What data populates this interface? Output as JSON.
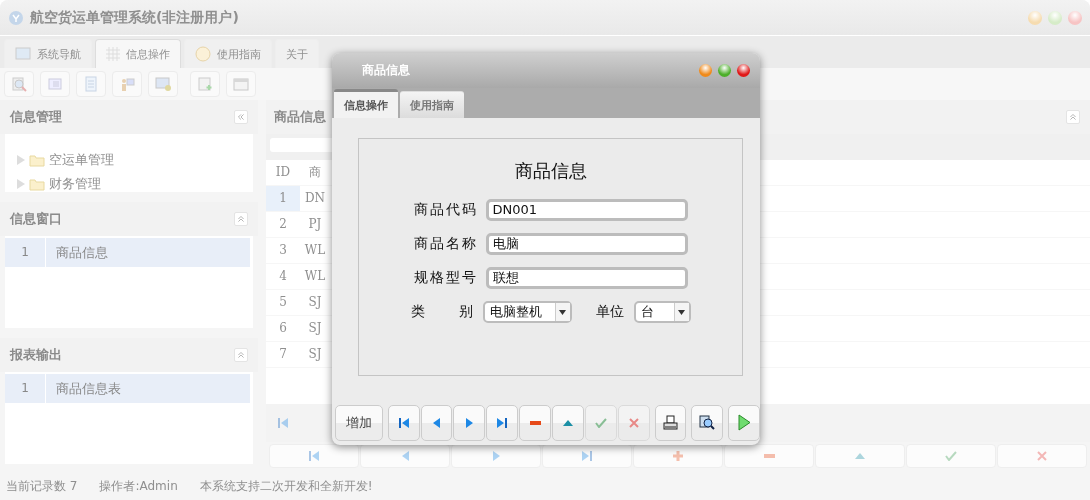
{
  "window": {
    "title": "航空货运单管理系统(非注册用户)"
  },
  "tabs": [
    {
      "label": "系统导航",
      "selected": false
    },
    {
      "label": "信息操作",
      "selected": true
    },
    {
      "label": "使用指南",
      "selected": false
    },
    {
      "label": "关于",
      "selected": false
    }
  ],
  "sidebar": {
    "tree": {
      "title": "信息管理",
      "items": [
        "空运单管理",
        "财务管理"
      ]
    },
    "panels": [
      {
        "title": "信息窗口",
        "rows": [
          {
            "number": "1",
            "label": "商品信息",
            "selected": true
          }
        ]
      },
      {
        "title": "报表输出",
        "rows": [
          {
            "number": "1",
            "label": "商品信息表",
            "selected": true
          }
        ]
      }
    ]
  },
  "main": {
    "title": "商品信息",
    "table": {
      "columns": [
        "ID",
        "商"
      ],
      "rows": [
        {
          "id": "1",
          "code": "DN",
          "selected": true
        },
        {
          "id": "2",
          "code": "PJ",
          "selected": false
        },
        {
          "id": "3",
          "code": "WL",
          "selected": false
        },
        {
          "id": "4",
          "code": "WL",
          "selected": false
        },
        {
          "id": "5",
          "code": "SJ",
          "selected": false
        },
        {
          "id": "6",
          "code": "SJ",
          "selected": false
        },
        {
          "id": "7",
          "code": "SJ",
          "selected": false
        }
      ]
    }
  },
  "status_bar": [
    "当前记录数 7",
    "操作者:Admin",
    "本系统支持二次开发和全新开发!"
  ],
  "dialog": {
    "title": "商品信息",
    "tabs": [
      {
        "label": "信息操作",
        "selected": true
      },
      {
        "label": "使用指南",
        "selected": false
      }
    ],
    "form_title": "商品信息",
    "fields": [
      {
        "label": "商品代码",
        "value": "DN001"
      },
      {
        "label": "商品名称",
        "value": "电脑"
      },
      {
        "label": "规格型号",
        "value": "联想"
      }
    ],
    "selects": [
      {
        "label": "类　　别",
        "value": "电脑整机"
      },
      {
        "label": "单位",
        "value": "台"
      }
    ],
    "buttons": [
      {
        "kind": "text",
        "label": "增加",
        "disabled": false
      },
      {
        "kind": "first",
        "disabled": false
      },
      {
        "kind": "prev",
        "disabled": false
      },
      {
        "kind": "next",
        "disabled": false
      },
      {
        "kind": "last",
        "disabled": false
      },
      {
        "kind": "minus",
        "disabled": false
      },
      {
        "kind": "up",
        "disabled": false
      },
      {
        "kind": "check",
        "disabled": true
      },
      {
        "kind": "cross",
        "disabled": true
      },
      {
        "kind": "print",
        "disabled": false
      },
      {
        "kind": "preview",
        "disabled": false
      },
      {
        "kind": "play",
        "disabled": false
      }
    ]
  }
}
